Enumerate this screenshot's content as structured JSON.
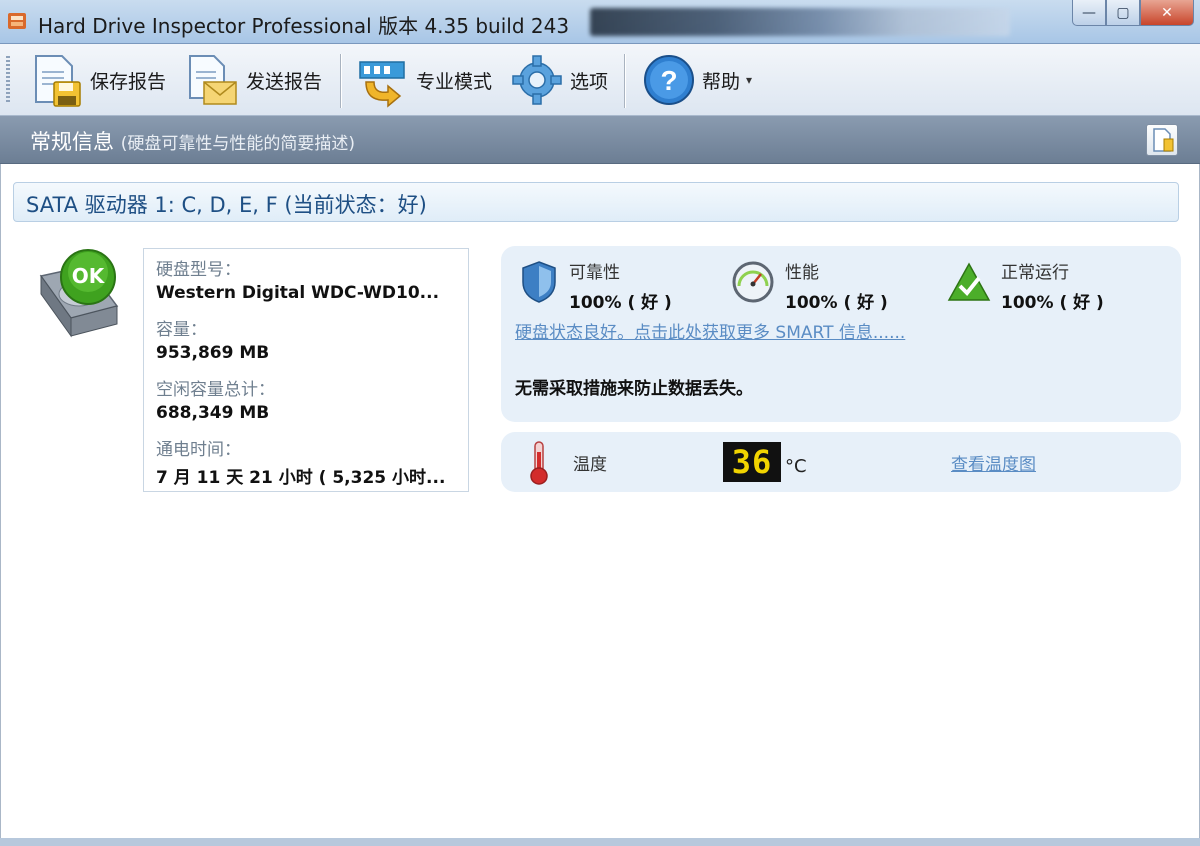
{
  "window": {
    "title": "Hard Drive Inspector Professional 版本 4.35 build 243",
    "controls": {
      "minimize": "—",
      "maximize": "▢",
      "close": "✕"
    }
  },
  "toolbar": {
    "items": [
      {
        "label": "保存报告",
        "icon": "save-report-icon"
      },
      {
        "label": "发送报告",
        "icon": "send-report-icon"
      },
      {
        "label": "专业模式",
        "icon": "expert-mode-icon"
      },
      {
        "label": "选项",
        "icon": "options-gear-icon"
      },
      {
        "label": "帮助",
        "icon": "help-icon",
        "dropdown": "▾"
      }
    ]
  },
  "section": {
    "title": "常规信息",
    "subtitle": "(硬盘可靠性与性能的简要描述)"
  },
  "drive": {
    "header": "SATA 驱动器 1: C, D, E, F (当前状态：好)",
    "ok_badge": "OK",
    "model_label": "硬盘型号：",
    "model_value": "Western Digital WDC-WD10...",
    "capacity_label": "容量：",
    "capacity_value": "953,869 MB",
    "free_label": "空闲容量总计：",
    "free_value": "688,349 MB",
    "power_label": "通电时间：",
    "power_value": "7 月 11 天 21 小时 ( 5,325 小时..."
  },
  "status": {
    "reliability": {
      "name": "可靠性",
      "value": "100% ( 好 )"
    },
    "performance": {
      "name": "性能",
      "value": "100% ( 好 )"
    },
    "uptime": {
      "name": "正常运行",
      "value": "100% ( 好 )"
    },
    "smart_link": "硬盘状态良好。点击此处获取更多 SMART 信息......",
    "advice": "无需采取措施来防止数据丢失。"
  },
  "temperature": {
    "label": "温度",
    "value": "36",
    "unit": "°C",
    "link": "查看温度图"
  },
  "colors": {
    "accent_blue": "#1e4f84",
    "link_blue": "#5a8cc4",
    "ok_green": "#3fa21f",
    "panel_bg": "#e7f0f9",
    "led_yellow": "#f2d400"
  }
}
